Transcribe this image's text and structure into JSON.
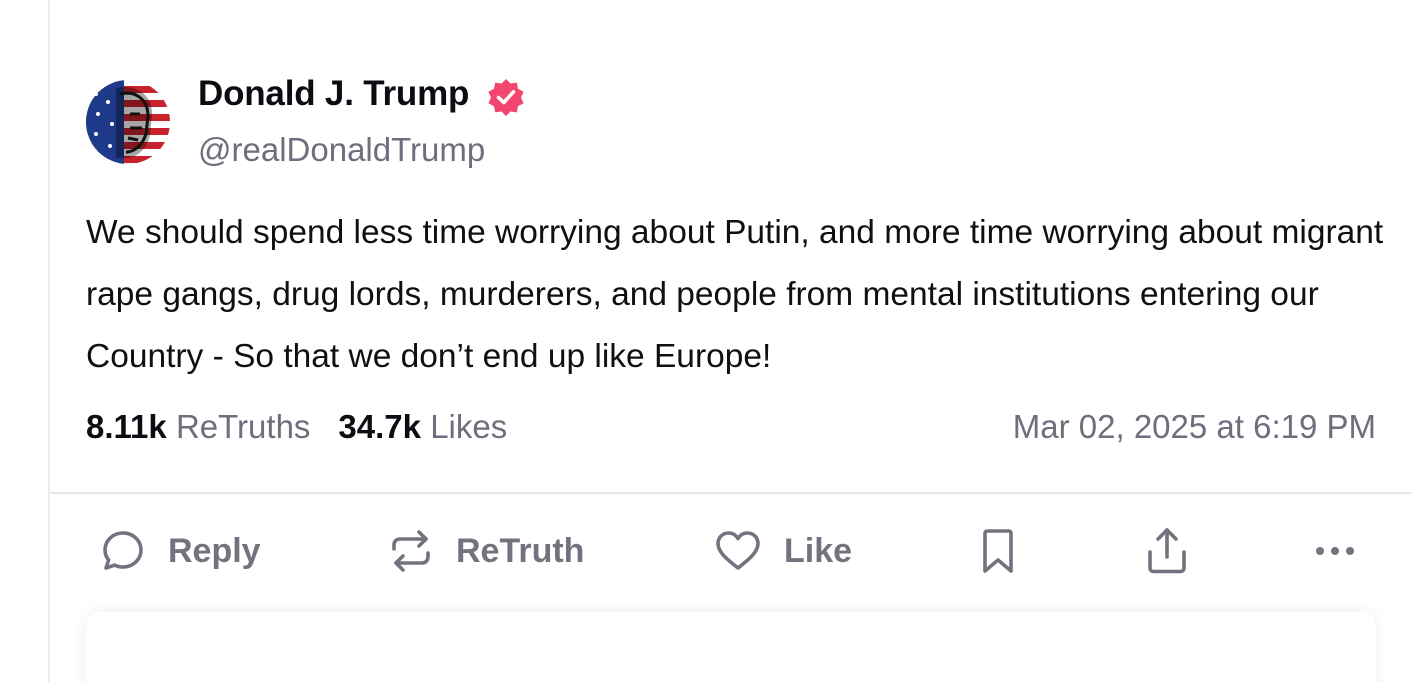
{
  "post": {
    "author": {
      "name": "Donald J. Trump",
      "handle": "@realDonaldTrump",
      "verified_color": "#f2466e",
      "avatar_icon": "flag-portrait-avatar"
    },
    "text": "We should spend less time worrying about Putin, and more time worrying about migrant rape gangs, drug lords, murderers, and people from mental institutions entering our Country - So that we don’t end up like Europe!",
    "stats": {
      "retruths_count": "8.11k",
      "retruths_label": "ReTruths",
      "likes_count": "34.7k",
      "likes_label": "Likes"
    },
    "timestamp": "Mar 02, 2025 at 6:19 PM"
  },
  "actions": {
    "reply_label": "Reply",
    "retruth_label": "ReTruth",
    "like_label": "Like",
    "icons": [
      "reply-icon",
      "retruth-icon",
      "heart-icon",
      "bookmark-icon",
      "share-icon",
      "more-icon"
    ]
  },
  "colors": {
    "text_primary": "#0f0f14",
    "text_secondary": "#6e6e7c",
    "action_gray": "#73737f",
    "divider": "#e6e6ec"
  }
}
